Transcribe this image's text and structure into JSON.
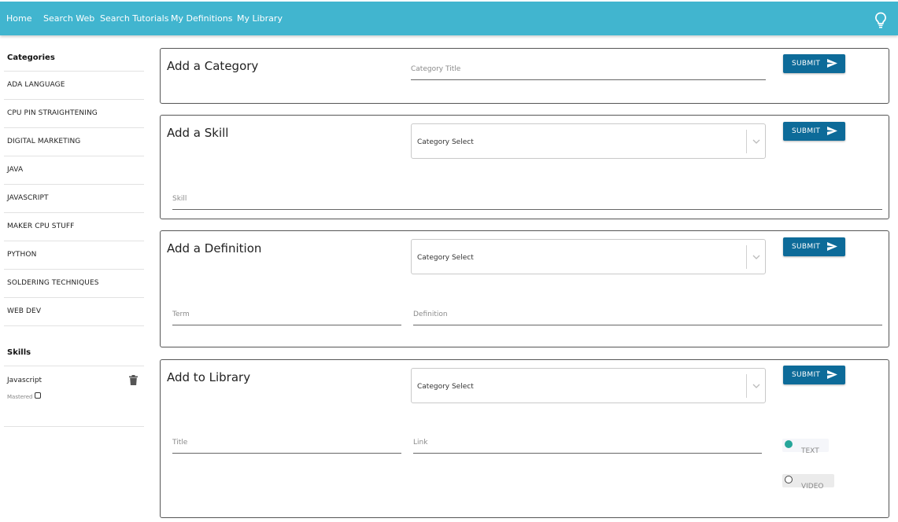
{
  "nav": {
    "items": [
      "Home",
      "Search Web",
      "Search Tutorials",
      "My Definitions",
      "My Library"
    ],
    "icon": "lightbulb-icon"
  },
  "sidebar": {
    "categories_heading": "Categories",
    "categories": [
      "ADA LANGUAGE",
      "CPU PIN STRAIGHTENING",
      "DIGITAL MARKETING",
      "JAVA",
      "JAVASCRIPT",
      "MAKER CPU STUFF",
      "PYTHON",
      "SOLDERING TECHNIQUES",
      "WEB DEV"
    ],
    "skills_heading": "Skills",
    "skill": {
      "name": "Javascript",
      "mastered_label": "Mastered",
      "mastered_checked": false
    }
  },
  "forms": {
    "category": {
      "title": "Add a Category",
      "title_field_label": "Category Title",
      "submit": "SUBMIT"
    },
    "skill": {
      "title": "Add a Skill",
      "select_label": "Category Select",
      "skill_field_label": "Skill",
      "submit": "SUBMIT"
    },
    "definition": {
      "title": "Add a Definition",
      "select_label": "Category Select",
      "term_field_label": "Term",
      "definition_field_label": "Definition",
      "submit": "SUBMIT"
    },
    "library": {
      "title": "Add to Library",
      "select_label": "Category Select",
      "title_field_label": "Title",
      "link_field_label": "Link",
      "submit": "SUBMIT",
      "options": [
        {
          "label": "TEXT",
          "selected": true
        },
        {
          "label": "VIDEO",
          "selected": false
        }
      ]
    }
  },
  "colors": {
    "nav_bg": "#41b5cf",
    "button_bg": "#0d6b99",
    "radio_selected": "#26a69a"
  }
}
